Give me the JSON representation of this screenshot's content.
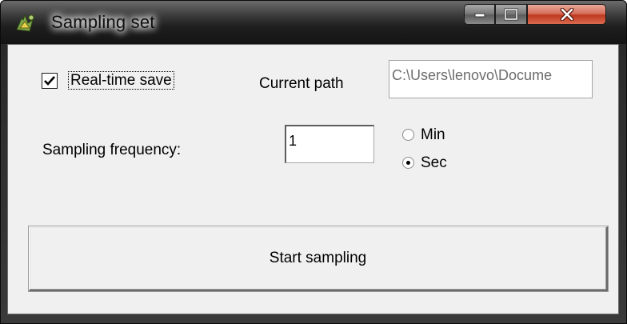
{
  "window": {
    "title": "Sampling set",
    "controls": {
      "minimize": "minimize-icon",
      "maximize": "maximize-icon",
      "close": "close-icon"
    }
  },
  "form": {
    "realtime_save": {
      "label": "Real-time save",
      "checked": true
    },
    "current_path": {
      "label": "Current path",
      "value": "C:\\Users\\lenovo\\Docume"
    },
    "sampling_frequency": {
      "label": "Sampling frequency:",
      "value": "1"
    },
    "unit": {
      "options": [
        {
          "label": "Min",
          "selected": false
        },
        {
          "label": "Sec",
          "selected": true
        }
      ]
    },
    "start_button": {
      "label": "Start sampling"
    }
  },
  "colors": {
    "dialog_bg": "#f0f0f0",
    "close_button": "#c0391f",
    "titlebar": "#1e1e1e"
  }
}
